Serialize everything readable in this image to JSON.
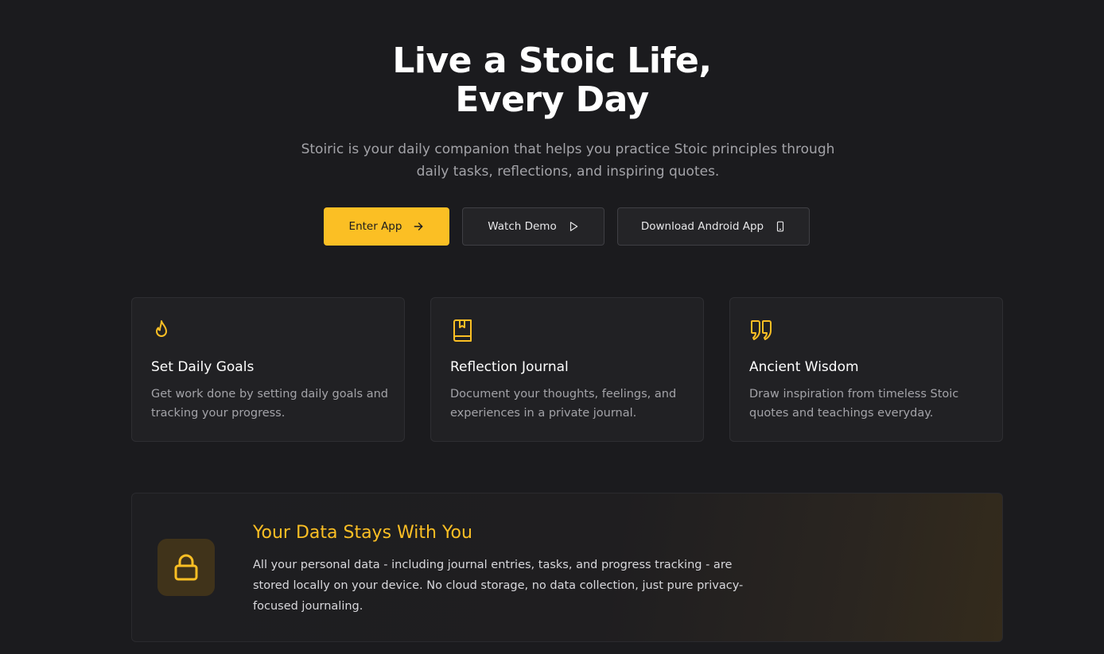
{
  "hero": {
    "title_line1": "Live a Stoic Life,",
    "title_line2": "Every Day",
    "subtitle": "Stoiric is your daily companion that helps you practice Stoic principles through daily tasks, reflections, and inspiring quotes."
  },
  "buttons": {
    "enter_app": "Enter App",
    "enter_app_icon": "arrow-right-icon",
    "watch_demo": "Watch Demo",
    "watch_demo_icon": "play-icon",
    "download_android": "Download Android App",
    "download_android_icon": "smartphone-icon"
  },
  "features": [
    {
      "icon": "flame-icon",
      "title": "Set Daily Goals",
      "description": "Get work done by setting daily goals and tracking your progress."
    },
    {
      "icon": "book-bookmark-icon",
      "title": "Reflection Journal",
      "description": "Document your thoughts, feelings, and experiences in a private journal."
    },
    {
      "icon": "quote-icon",
      "title": "Ancient Wisdom",
      "description": "Draw inspiration from timeless Stoic quotes and teachings everyday."
    }
  ],
  "privacy": {
    "icon": "lock-icon",
    "title": "Your Data Stays With You",
    "text": "All your personal data - including journal entries, tasks, and progress tracking - are stored locally on your device. No cloud storage, no data collection, just pure privacy-focused journaling."
  },
  "colors": {
    "background": "#1b1b1e",
    "accent": "#fbbf24",
    "card": "#212124",
    "muted_text": "#a3a3a8"
  }
}
